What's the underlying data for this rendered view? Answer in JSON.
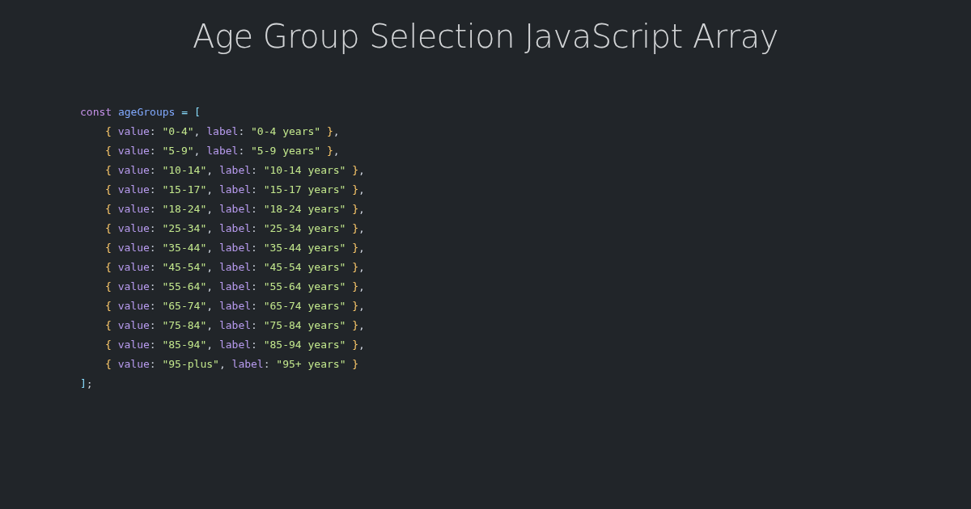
{
  "title": "Age Group Selection JavaScript Array",
  "code": {
    "lines": [
      {
        "tokens": [
          {
            "kind": "keyword",
            "text": "const "
          },
          {
            "kind": "variable",
            "text": "ageGroups"
          },
          {
            "kind": "operator",
            "text": " = "
          },
          {
            "kind": "bracket",
            "text": "["
          }
        ],
        "children": [
          {
            "tokens": [
              {
                "kind": "brace",
                "text": "{ "
              },
              {
                "kind": "property",
                "text": "value"
              },
              {
                "kind": "punct",
                "text": ": "
              },
              {
                "kind": "string",
                "text": "\"0-4\""
              },
              {
                "kind": "punct",
                "text": ", "
              },
              {
                "kind": "property",
                "text": "label"
              },
              {
                "kind": "punct",
                "text": ": "
              },
              {
                "kind": "string",
                "text": "\"0-4 years\""
              },
              {
                "kind": "brace",
                "text": " }"
              },
              {
                "kind": "punct",
                "text": ","
              }
            ]
          },
          {
            "tokens": [
              {
                "kind": "brace",
                "text": "{ "
              },
              {
                "kind": "property",
                "text": "value"
              },
              {
                "kind": "punct",
                "text": ": "
              },
              {
                "kind": "string",
                "text": "\"5-9\""
              },
              {
                "kind": "punct",
                "text": ", "
              },
              {
                "kind": "property",
                "text": "label"
              },
              {
                "kind": "punct",
                "text": ": "
              },
              {
                "kind": "string",
                "text": "\"5-9 years\""
              },
              {
                "kind": "brace",
                "text": " }"
              },
              {
                "kind": "punct",
                "text": ","
              }
            ]
          },
          {
            "tokens": [
              {
                "kind": "brace",
                "text": "{ "
              },
              {
                "kind": "property",
                "text": "value"
              },
              {
                "kind": "punct",
                "text": ": "
              },
              {
                "kind": "string",
                "text": "\"10-14\""
              },
              {
                "kind": "punct",
                "text": ", "
              },
              {
                "kind": "property",
                "text": "label"
              },
              {
                "kind": "punct",
                "text": ": "
              },
              {
                "kind": "string",
                "text": "\"10-14 years\""
              },
              {
                "kind": "brace",
                "text": " }"
              },
              {
                "kind": "punct",
                "text": ","
              }
            ]
          },
          {
            "tokens": [
              {
                "kind": "brace",
                "text": "{ "
              },
              {
                "kind": "property",
                "text": "value"
              },
              {
                "kind": "punct",
                "text": ": "
              },
              {
                "kind": "string",
                "text": "\"15-17\""
              },
              {
                "kind": "punct",
                "text": ", "
              },
              {
                "kind": "property",
                "text": "label"
              },
              {
                "kind": "punct",
                "text": ": "
              },
              {
                "kind": "string",
                "text": "\"15-17 years\""
              },
              {
                "kind": "brace",
                "text": " }"
              },
              {
                "kind": "punct",
                "text": ","
              }
            ]
          },
          {
            "tokens": [
              {
                "kind": "brace",
                "text": "{ "
              },
              {
                "kind": "property",
                "text": "value"
              },
              {
                "kind": "punct",
                "text": ": "
              },
              {
                "kind": "string",
                "text": "\"18-24\""
              },
              {
                "kind": "punct",
                "text": ", "
              },
              {
                "kind": "property",
                "text": "label"
              },
              {
                "kind": "punct",
                "text": ": "
              },
              {
                "kind": "string",
                "text": "\"18-24 years\""
              },
              {
                "kind": "brace",
                "text": " }"
              },
              {
                "kind": "punct",
                "text": ","
              }
            ]
          },
          {
            "tokens": [
              {
                "kind": "brace",
                "text": "{ "
              },
              {
                "kind": "property",
                "text": "value"
              },
              {
                "kind": "punct",
                "text": ": "
              },
              {
                "kind": "string",
                "text": "\"25-34\""
              },
              {
                "kind": "punct",
                "text": ", "
              },
              {
                "kind": "property",
                "text": "label"
              },
              {
                "kind": "punct",
                "text": ": "
              },
              {
                "kind": "string",
                "text": "\"25-34 years\""
              },
              {
                "kind": "brace",
                "text": " }"
              },
              {
                "kind": "punct",
                "text": ","
              }
            ]
          },
          {
            "tokens": [
              {
                "kind": "brace",
                "text": "{ "
              },
              {
                "kind": "property",
                "text": "value"
              },
              {
                "kind": "punct",
                "text": ": "
              },
              {
                "kind": "string",
                "text": "\"35-44\""
              },
              {
                "kind": "punct",
                "text": ", "
              },
              {
                "kind": "property",
                "text": "label"
              },
              {
                "kind": "punct",
                "text": ": "
              },
              {
                "kind": "string",
                "text": "\"35-44 years\""
              },
              {
                "kind": "brace",
                "text": " }"
              },
              {
                "kind": "punct",
                "text": ","
              }
            ]
          },
          {
            "tokens": [
              {
                "kind": "brace",
                "text": "{ "
              },
              {
                "kind": "property",
                "text": "value"
              },
              {
                "kind": "punct",
                "text": ": "
              },
              {
                "kind": "string",
                "text": "\"45-54\""
              },
              {
                "kind": "punct",
                "text": ", "
              },
              {
                "kind": "property",
                "text": "label"
              },
              {
                "kind": "punct",
                "text": ": "
              },
              {
                "kind": "string",
                "text": "\"45-54 years\""
              },
              {
                "kind": "brace",
                "text": " }"
              },
              {
                "kind": "punct",
                "text": ","
              }
            ]
          },
          {
            "tokens": [
              {
                "kind": "brace",
                "text": "{ "
              },
              {
                "kind": "property",
                "text": "value"
              },
              {
                "kind": "punct",
                "text": ": "
              },
              {
                "kind": "string",
                "text": "\"55-64\""
              },
              {
                "kind": "punct",
                "text": ", "
              },
              {
                "kind": "property",
                "text": "label"
              },
              {
                "kind": "punct",
                "text": ": "
              },
              {
                "kind": "string",
                "text": "\"55-64 years\""
              },
              {
                "kind": "brace",
                "text": " }"
              },
              {
                "kind": "punct",
                "text": ","
              }
            ]
          },
          {
            "tokens": [
              {
                "kind": "brace",
                "text": "{ "
              },
              {
                "kind": "property",
                "text": "value"
              },
              {
                "kind": "punct",
                "text": ": "
              },
              {
                "kind": "string",
                "text": "\"65-74\""
              },
              {
                "kind": "punct",
                "text": ", "
              },
              {
                "kind": "property",
                "text": "label"
              },
              {
                "kind": "punct",
                "text": ": "
              },
              {
                "kind": "string",
                "text": "\"65-74 years\""
              },
              {
                "kind": "brace",
                "text": " }"
              },
              {
                "kind": "punct",
                "text": ","
              }
            ]
          },
          {
            "tokens": [
              {
                "kind": "brace",
                "text": "{ "
              },
              {
                "kind": "property",
                "text": "value"
              },
              {
                "kind": "punct",
                "text": ": "
              },
              {
                "kind": "string",
                "text": "\"75-84\""
              },
              {
                "kind": "punct",
                "text": ", "
              },
              {
                "kind": "property",
                "text": "label"
              },
              {
                "kind": "punct",
                "text": ": "
              },
              {
                "kind": "string",
                "text": "\"75-84 years\""
              },
              {
                "kind": "brace",
                "text": " }"
              },
              {
                "kind": "punct",
                "text": ","
              }
            ]
          },
          {
            "tokens": [
              {
                "kind": "brace",
                "text": "{ "
              },
              {
                "kind": "property",
                "text": "value"
              },
              {
                "kind": "punct",
                "text": ": "
              },
              {
                "kind": "string",
                "text": "\"85-94\""
              },
              {
                "kind": "punct",
                "text": ", "
              },
              {
                "kind": "property",
                "text": "label"
              },
              {
                "kind": "punct",
                "text": ": "
              },
              {
                "kind": "string",
                "text": "\"85-94 years\""
              },
              {
                "kind": "brace",
                "text": " }"
              },
              {
                "kind": "punct",
                "text": ","
              }
            ]
          },
          {
            "tokens": [
              {
                "kind": "brace",
                "text": "{ "
              },
              {
                "kind": "property",
                "text": "value"
              },
              {
                "kind": "punct",
                "text": ": "
              },
              {
                "kind": "string",
                "text": "\"95-plus\""
              },
              {
                "kind": "punct",
                "text": ", "
              },
              {
                "kind": "property",
                "text": "label"
              },
              {
                "kind": "punct",
                "text": ": "
              },
              {
                "kind": "string",
                "text": "\"95+ years\""
              },
              {
                "kind": "brace",
                "text": " }"
              }
            ]
          }
        ]
      },
      {
        "tokens": [
          {
            "kind": "bracket",
            "text": "]"
          },
          {
            "kind": "punct",
            "text": ";"
          }
        ]
      }
    ]
  }
}
